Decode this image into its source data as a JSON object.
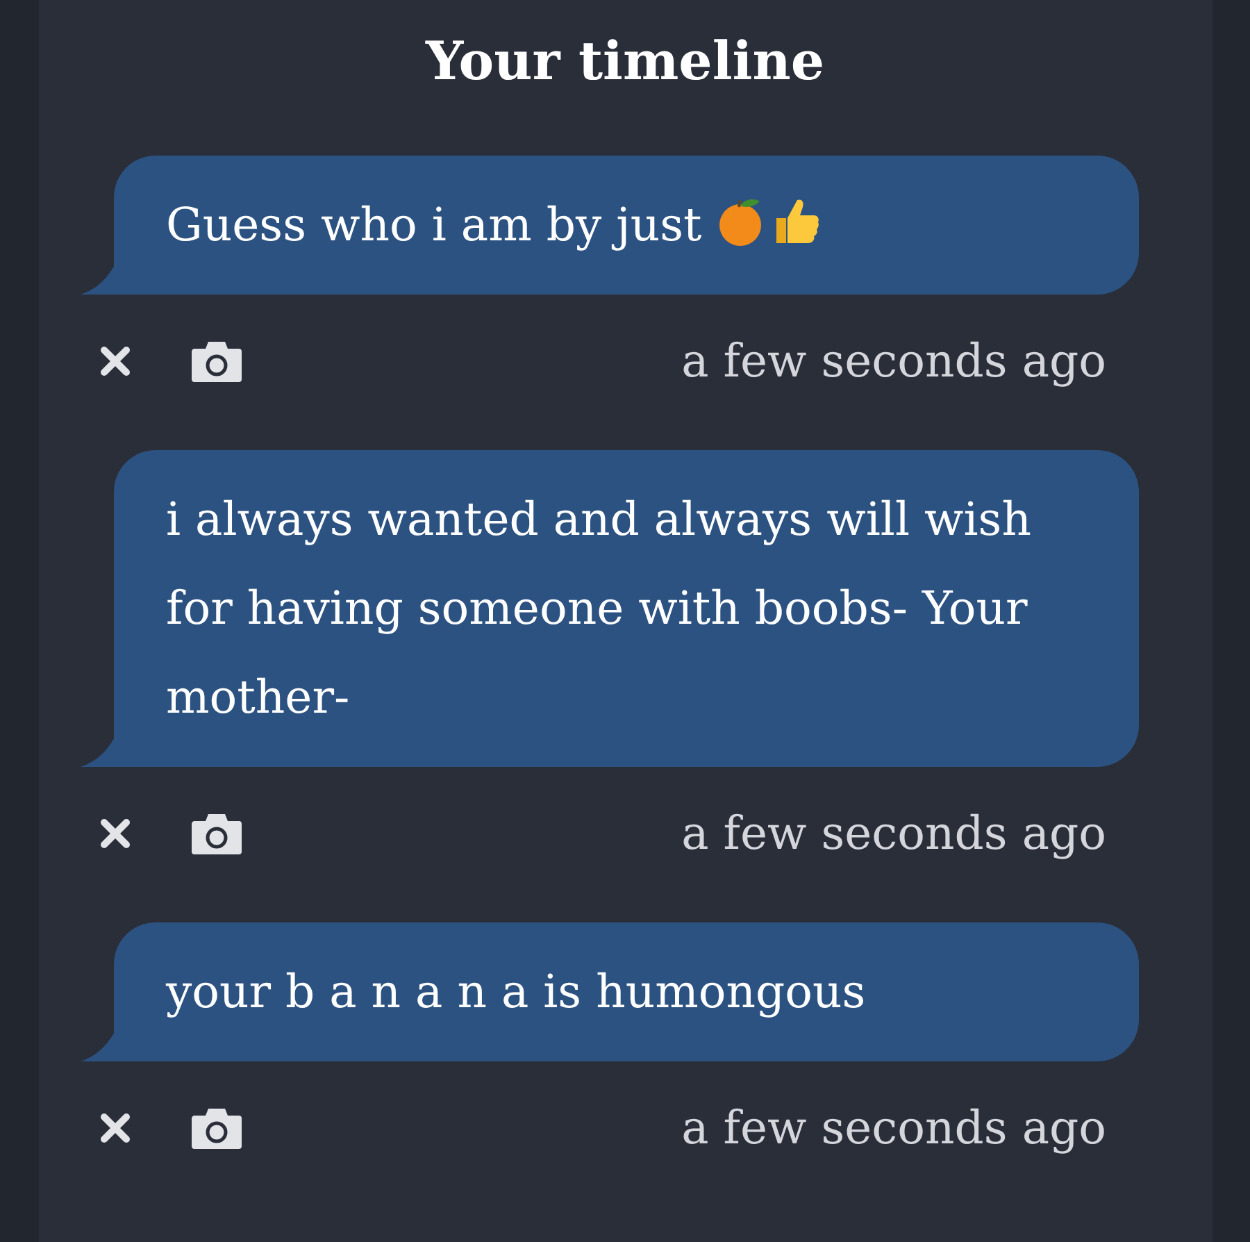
{
  "title": "Your timeline",
  "messages": [
    {
      "text": "Guess who i am by just",
      "kind": "text_with_emoji",
      "time": "a few seconds ago"
    },
    {
      "kind": "text",
      "text": "i always wanted and always will wish for having someone with boobs- Your mother-",
      "time": "a few seconds ago"
    },
    {
      "kind": "text",
      "text": "your b a n a n a is humongous",
      "time": "a few seconds ago"
    }
  ]
}
